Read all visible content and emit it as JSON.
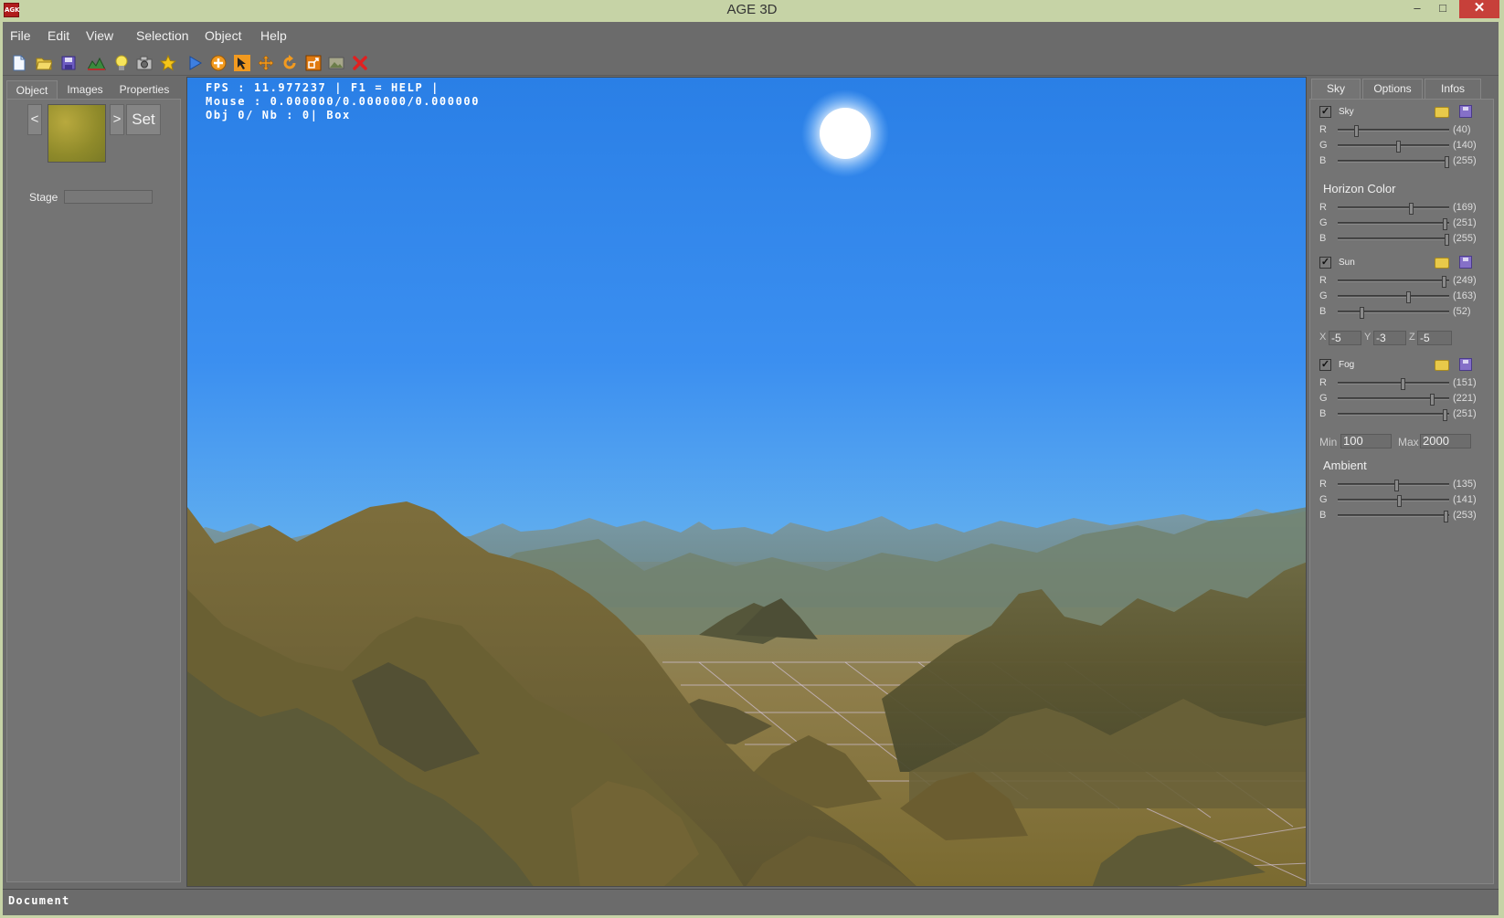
{
  "window": {
    "title": "AGE 3D",
    "app_icon_text": "AGK",
    "minimize": "–",
    "maximize": "□",
    "close": "✕"
  },
  "menu": [
    "File",
    "Edit",
    "View",
    "Selection",
    "Object",
    "Help"
  ],
  "toolbar": {
    "icons": [
      "new-file-icon",
      "open-folder-icon",
      "save-icon",
      "terrain-icon",
      "light-bulb-icon",
      "camera-icon",
      "star-icon",
      "play-icon",
      "add-object-icon",
      "select-icon",
      "move-icon",
      "rotate-icon",
      "scale-icon",
      "image-icon",
      "delete-icon"
    ]
  },
  "left_panel": {
    "tabs": [
      "Object",
      "Images",
      "Properties"
    ],
    "prev_label": "<",
    "next_label": ">",
    "set_label": "Set",
    "stage_label": "Stage"
  },
  "viewport": {
    "hud_fps": "FPS : 11.977237 | F1 = HELP |",
    "hud_mouse": "Mouse : 0.000000/0.000000/0.000000",
    "hud_obj": "Obj 0/ Nb : 0| Box"
  },
  "right_panel": {
    "tabs": [
      "Sky",
      "Options",
      "Infos"
    ],
    "sky": {
      "label": "Sky",
      "enabled": true,
      "R": 40,
      "G": 140,
      "B": 255,
      "R_text": "(40)",
      "G_text": "(140)",
      "B_text": "(255)"
    },
    "horizon": {
      "title": "Horizon  Color",
      "R": 169,
      "G": 251,
      "B": 255,
      "R_text": "(169)",
      "G_text": "(251)",
      "B_text": "(255)"
    },
    "sun": {
      "label": "Sun",
      "enabled": true,
      "R": 249,
      "G": 163,
      "B": 52,
      "R_text": "(249)",
      "G_text": "(163)",
      "B_text": "(52)",
      "x_label": "X",
      "y_label": "Y",
      "z_label": "Z",
      "x": "-5",
      "y": "-3",
      "z": "-5"
    },
    "fog": {
      "label": "Fog",
      "enabled": true,
      "R": 151,
      "G": 221,
      "B": 251,
      "R_text": "(151)",
      "G_text": "(221)",
      "B_text": "(251)",
      "min_label": "Min",
      "min": "100",
      "max_label": "Max",
      "max": "2000"
    },
    "ambient": {
      "title": "Ambient",
      "R": 135,
      "G": 141,
      "B": 253,
      "R_text": "(135)",
      "G_text": "(141)",
      "B_text": "(253)"
    },
    "letters": {
      "r": "R",
      "g": "G",
      "b": "B"
    },
    "check_mark": "✓"
  },
  "status": {
    "text": "Document"
  },
  "colors": {
    "chrome": "#6b6b6b",
    "titlebar": "#c6d3a6",
    "close": "#c7403a",
    "sky_top": "#2a7fe6",
    "sky_horizon": "#a6dcf0"
  }
}
